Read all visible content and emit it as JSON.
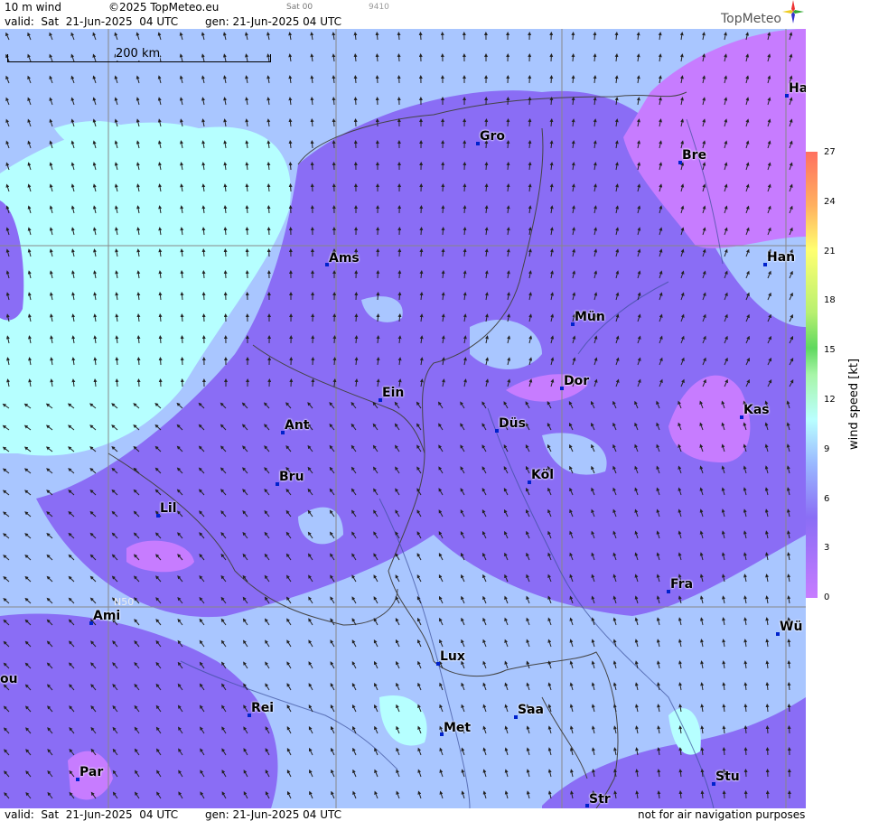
{
  "header": {
    "field": "10 m wind",
    "copyright": "©2025 TopMeteo.eu",
    "run": "Sat 00",
    "code": "9410",
    "valid": "valid:  Sat  21-Jun-2025  04 UTC",
    "gen": "gen: 21-Jun-2025 04 UTC",
    "brand": "TopMeteo"
  },
  "footer": {
    "valid": "valid:  Sat  21-Jun-2025  04 UTC",
    "gen": "gen: 21-Jun-2025 04 UTC",
    "disclaimer": "not for air navigation purposes"
  },
  "map": {
    "scale_label": "200 km",
    "latitude_label": "N50",
    "cities": [
      "Ha",
      "Gro",
      "Bre",
      "Ams",
      "Han",
      "Mün",
      "Dor",
      "Ein",
      "Kas",
      "Düs",
      "Ant",
      "Köl",
      "Bru",
      "Lil",
      "Fra",
      "Ami",
      "Wü",
      "Lux",
      "ou",
      "Rei",
      "Saa",
      "Met",
      "Par",
      "Stu",
      "Str"
    ]
  },
  "legend": {
    "title": "wind  speed  [kt]",
    "ticks": [
      "27",
      "24",
      "21",
      "18",
      "15",
      "12",
      "9",
      "6",
      "3",
      "0"
    ],
    "colors": [
      "#c77cff",
      "#8a6df5",
      "#9ab8ff",
      "#b9ffff",
      "#a8f5a8",
      "#5fd85f",
      "#b8f070",
      "#ffff70",
      "#ffb060",
      "#ff7060"
    ]
  }
}
